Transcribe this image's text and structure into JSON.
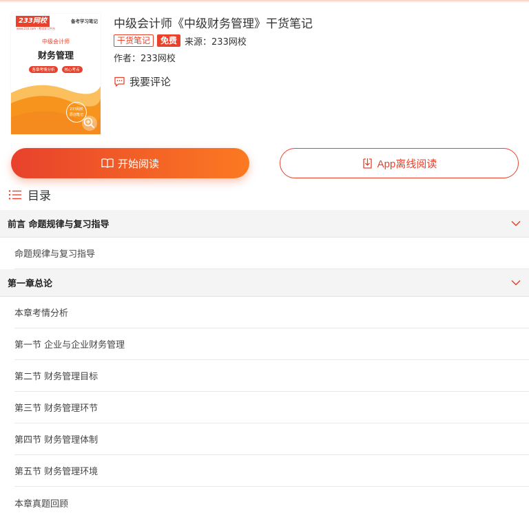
{
  "cover": {
    "logo_text": "233网校",
    "logo_sub": "www.233.com · 考试学习平台",
    "tagline": "备考学习笔记",
    "exam": "中级会计师",
    "subject": "财务管理",
    "tags": [
      "各章考情分析",
      "核心考点"
    ],
    "stamp_line1": "233网校",
    "stamp_line2": "原创笔记",
    "colors": {
      "orange": "#f7941d",
      "light": "#fbbf5e",
      "red": "#e8412c"
    }
  },
  "book": {
    "title": "中级会计师《中级财务管理》干货笔记",
    "badge_type": "干货笔记",
    "badge_free": "免费",
    "source": "来源：233网校",
    "author": "作者：233网校",
    "comment_label": "我要评论"
  },
  "buttons": {
    "read_label": "开始阅读",
    "offline_label": "App离线阅读"
  },
  "toc": {
    "title": "目录",
    "chapters": [
      {
        "title": "前言 命题规律与复习指导",
        "sections": [
          "命题规律与复习指导"
        ]
      },
      {
        "title": "第一章总论",
        "sections": [
          "本章考情分析",
          "第一节 企业与企业财务管理",
          "第二节 财务管理目标",
          "第三节 财务管理环节",
          "第四节 财务管理体制",
          "第五节 财务管理环境",
          "本章真题回顾"
        ]
      }
    ]
  },
  "theme": {
    "accent": "#e8412c",
    "gradient_end": "#fb7a22"
  }
}
